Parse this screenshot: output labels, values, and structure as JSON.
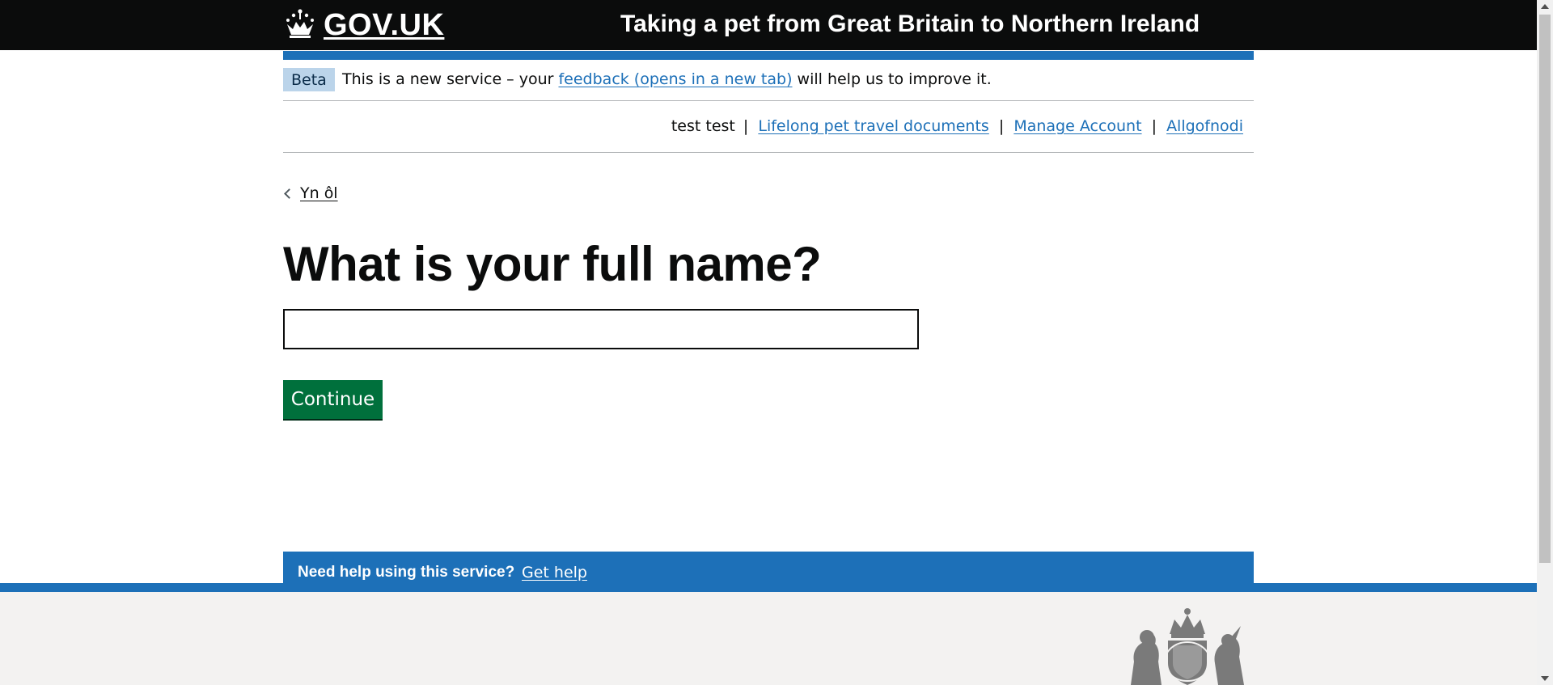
{
  "header": {
    "logo_text": "GOV.UK",
    "service_name": "Taking a pet from Great Britain to Northern Ireland"
  },
  "phase_banner": {
    "tag": "Beta",
    "text_before": "This is a new service – your ",
    "link": "feedback (opens in a new tab)",
    "text_after": " will help us to improve it."
  },
  "account_nav": {
    "user_name": "test test",
    "separator": "|",
    "links": [
      "Lifelong pet travel documents",
      "Manage Account",
      "Allgofnodi"
    ]
  },
  "back_link": "Yn ôl",
  "question": {
    "heading": "What is your full name?",
    "input_value": ""
  },
  "continue_button": "Continue",
  "help_banner": {
    "question": "Need help using this service?",
    "link": "Get help"
  },
  "colors": {
    "header_bg": "#0b0c0c",
    "brand_blue": "#1d70b8",
    "button_green": "#00703c",
    "footer_bg": "#f3f2f1"
  },
  "icons": [
    "crown-icon",
    "chevron-left-icon",
    "royal-crest-icon"
  ]
}
